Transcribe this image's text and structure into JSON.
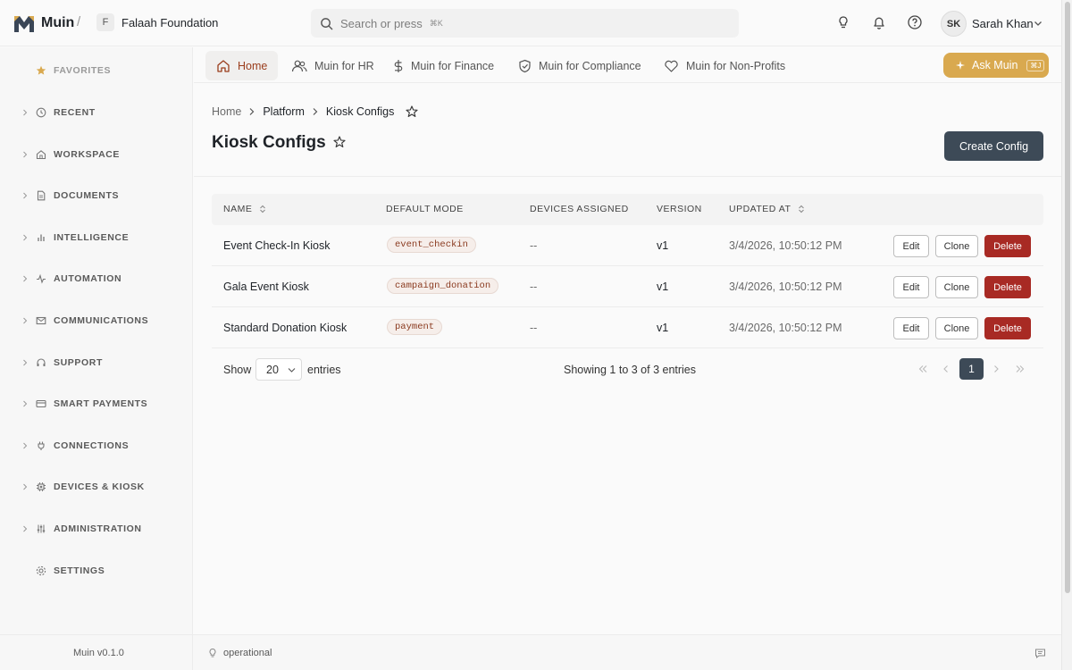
{
  "app": {
    "name": "Muin"
  },
  "org": {
    "initial": "F",
    "name": "Falaah Foundation"
  },
  "search": {
    "placeholder": "Search or press",
    "shortcut": "⌘K"
  },
  "user": {
    "initials": "SK",
    "name": "Sarah Khan"
  },
  "sidebar": {
    "favorites": "FAVORITES",
    "items": [
      {
        "label": "RECENT",
        "icon": "clock-icon"
      },
      {
        "label": "WORKSPACE",
        "icon": "home-icon"
      },
      {
        "label": "DOCUMENTS",
        "icon": "document-icon"
      },
      {
        "label": "INTELLIGENCE",
        "icon": "bar-chart-icon"
      },
      {
        "label": "AUTOMATION",
        "icon": "activity-icon"
      },
      {
        "label": "COMMUNICATIONS",
        "icon": "mail-icon"
      },
      {
        "label": "SUPPORT",
        "icon": "headset-icon"
      },
      {
        "label": "SMART PAYMENTS",
        "icon": "credit-card-icon"
      },
      {
        "label": "CONNECTIONS",
        "icon": "plug-icon"
      },
      {
        "label": "DEVICES & KIOSK",
        "icon": "chip-icon"
      },
      {
        "label": "ADMINISTRATION",
        "icon": "sliders-icon"
      }
    ],
    "settings": "SETTINGS",
    "version": "Muin v0.1.0"
  },
  "status": {
    "text": "operational"
  },
  "tabs": [
    {
      "label": "Home",
      "icon": "home-icon",
      "active": true
    },
    {
      "label": "Muin for HR",
      "icon": "users-icon"
    },
    {
      "label": "Muin for Finance",
      "icon": "dollar-icon"
    },
    {
      "label": "Muin for Compliance",
      "icon": "shield-icon"
    },
    {
      "label": "Muin for Non-Profits",
      "icon": "heart-icon"
    }
  ],
  "ask": {
    "label": "Ask Muin",
    "shortcut": "⌘J"
  },
  "breadcrumb": {
    "home": "Home",
    "platform": "Platform",
    "current": "Kiosk Configs"
  },
  "page": {
    "title": "Kiosk Configs",
    "create_label": "Create Config"
  },
  "table": {
    "columns": [
      "NAME",
      "DEFAULT MODE",
      "DEVICES ASSIGNED",
      "VERSION",
      "UPDATED AT"
    ],
    "rows": [
      {
        "name": "Event Check-In Kiosk",
        "mode": "event_checkin",
        "devices": "--",
        "version": "v1",
        "updated": "3/4/2026, 10:50:12 PM"
      },
      {
        "name": "Gala Event Kiosk",
        "mode": "campaign_donation",
        "devices": "--",
        "version": "v1",
        "updated": "3/4/2026, 10:50:12 PM"
      },
      {
        "name": "Standard Donation Kiosk",
        "mode": "payment",
        "devices": "--",
        "version": "v1",
        "updated": "3/4/2026, 10:50:12 PM"
      }
    ],
    "actions": {
      "edit": "Edit",
      "clone": "Clone",
      "delete": "Delete"
    }
  },
  "pager": {
    "show": "Show",
    "page_size": "20",
    "entries": "entries",
    "summary": "Showing 1 to 3 of 3 entries",
    "current_page": "1"
  },
  "colors": {
    "accent": "#9a3d1c",
    "ask": "#d9a94f",
    "primary": "#3d4a57",
    "danger": "#a82a24"
  }
}
